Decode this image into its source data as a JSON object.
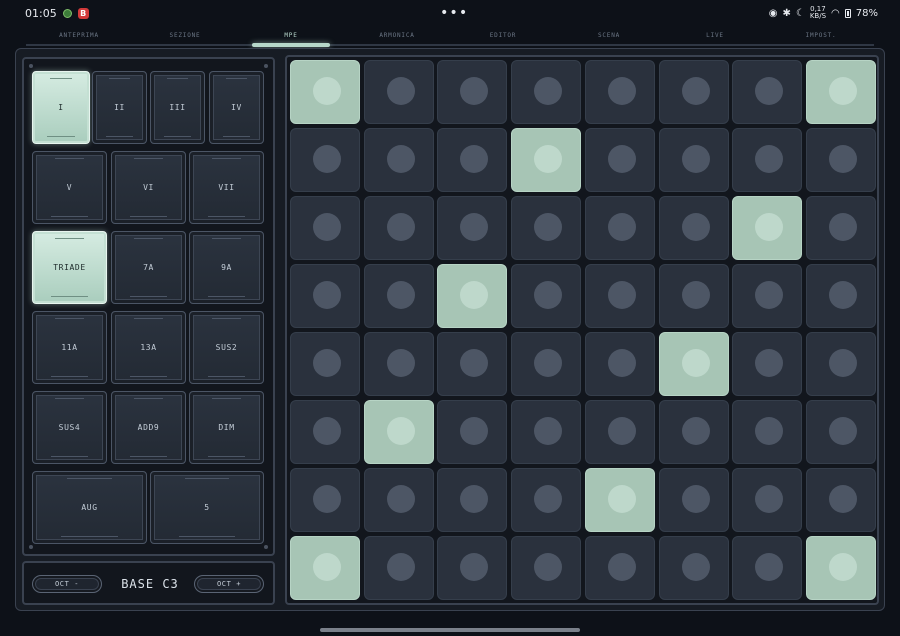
{
  "status": {
    "time": "01:05",
    "app_badge": "B",
    "speed_value": "0,17",
    "speed_unit": "KB/S",
    "battery": "78%"
  },
  "tabs": [
    {
      "label": "ANTEPRIMA",
      "active": false
    },
    {
      "label": "SEZIONE",
      "active": false
    },
    {
      "label": "MPE",
      "active": true
    },
    {
      "label": "ARMONICA",
      "active": false
    },
    {
      "label": "EDITOR",
      "active": false
    },
    {
      "label": "SCENA",
      "active": false
    },
    {
      "label": "LIVE",
      "active": false
    },
    {
      "label": "IMPOST.",
      "active": false
    }
  ],
  "chord_keys": [
    {
      "label": "I",
      "active": true
    },
    {
      "label": "II",
      "active": false
    },
    {
      "label": "III",
      "active": false
    },
    {
      "label": "IV",
      "active": false
    },
    {
      "label": "V",
      "active": false
    },
    {
      "label": "VI",
      "active": false
    },
    {
      "label": "VII",
      "active": false
    },
    {
      "label": "TRIADE",
      "active": true
    },
    {
      "label": "7A",
      "active": false
    },
    {
      "label": "9A",
      "active": false
    },
    {
      "label": "11A",
      "active": false
    },
    {
      "label": "13A",
      "active": false
    },
    {
      "label": "SUS2",
      "active": false
    },
    {
      "label": "SUS4",
      "active": false
    },
    {
      "label": "ADD9",
      "active": false
    },
    {
      "label": "DIM",
      "active": false
    },
    {
      "label": "AUG",
      "active": false
    },
    {
      "label": "5",
      "active": false
    }
  ],
  "base": {
    "oct_down": "OCT -",
    "label": "BASE C3",
    "oct_up": "OCT +"
  },
  "pad_grid": {
    "rows": 8,
    "cols": 8,
    "lit": [
      [
        0,
        0
      ],
      [
        0,
        7
      ],
      [
        1,
        3
      ],
      [
        2,
        6
      ],
      [
        3,
        2
      ],
      [
        4,
        5
      ],
      [
        5,
        1
      ],
      [
        6,
        4
      ],
      [
        7,
        0
      ],
      [
        7,
        7
      ]
    ]
  }
}
